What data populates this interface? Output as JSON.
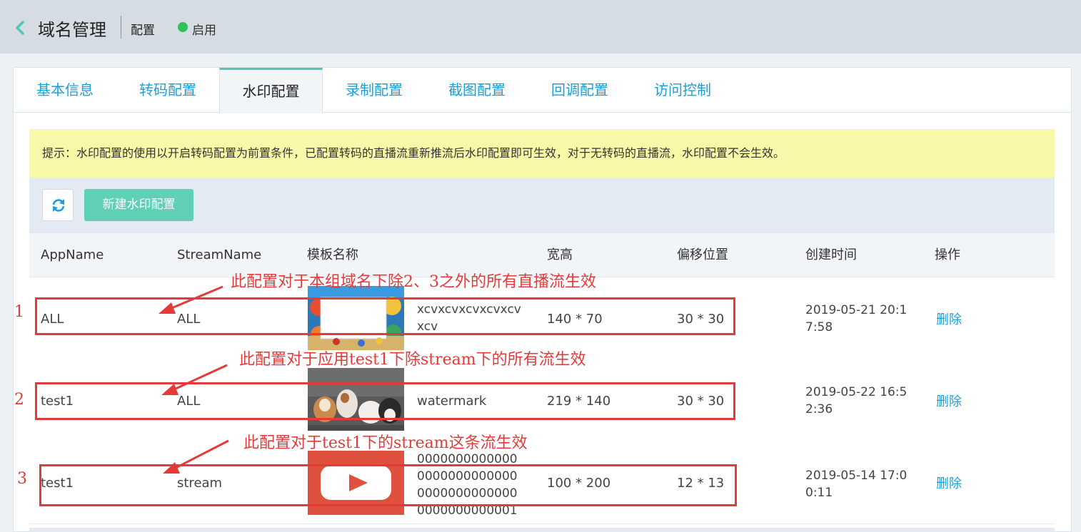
{
  "header": {
    "title": "域名管理",
    "crumb": "配置",
    "status": "启用",
    "status_color": "#2fc25b"
  },
  "tabs": [
    {
      "label": "基本信息"
    },
    {
      "label": "转码配置"
    },
    {
      "label": "水印配置",
      "active": true
    },
    {
      "label": "录制配置"
    },
    {
      "label": "截图配置"
    },
    {
      "label": "回调配置"
    },
    {
      "label": "访问控制"
    }
  ],
  "tip": "提示：水印配置的使用以开启转码配置为前置条件，已配置转码的直播流重新推流后水印配置即可生效，对于无转码的直播流，水印配置不会生效。",
  "toolbar": {
    "refresh_icon": "refresh-icon",
    "new_label": "新建水印配置"
  },
  "table": {
    "columns": [
      "AppName",
      "StreamName",
      "模板名称",
      "宽高",
      "偏移位置",
      "创建时间",
      "操作"
    ],
    "rows": [
      {
        "app": "ALL",
        "stream": "ALL",
        "template": "xcvxcvxcvxcvxcvxcv",
        "size": "140 * 70",
        "offset": "30 * 30",
        "created": "2019-05-21 20:17:58",
        "action": "删除",
        "thumb": "beach-collage-image"
      },
      {
        "app": "test1",
        "stream": "ALL",
        "template": "watermark",
        "size": "219 * 140",
        "offset": "30 * 30",
        "created": "2019-05-22 16:52:36",
        "action": "删除",
        "thumb": "puppies-photo"
      },
      {
        "app": "test1",
        "stream": "stream",
        "template": "0000000000000000000000000000000000000000000000000001",
        "size": "100 * 200",
        "offset": "12 * 13",
        "created": "2019-05-14 17:00:11",
        "action": "删除",
        "thumb": "youtube-logo"
      }
    ]
  },
  "annotations": [
    {
      "num": "1",
      "text": "此配置对于本组域名下除2、3之外的所有直播流生效"
    },
    {
      "num": "2",
      "text": "此配置对于应用test1下除stream下的所有流生效"
    },
    {
      "num": "3",
      "text": "此配置对于test1下的stream这条流生效"
    }
  ],
  "colors": {
    "accent": "#1b9fda",
    "primary_button": "#5fd0b5",
    "annotation": "#e53a3a",
    "tip_background": "#f8f8a9"
  }
}
